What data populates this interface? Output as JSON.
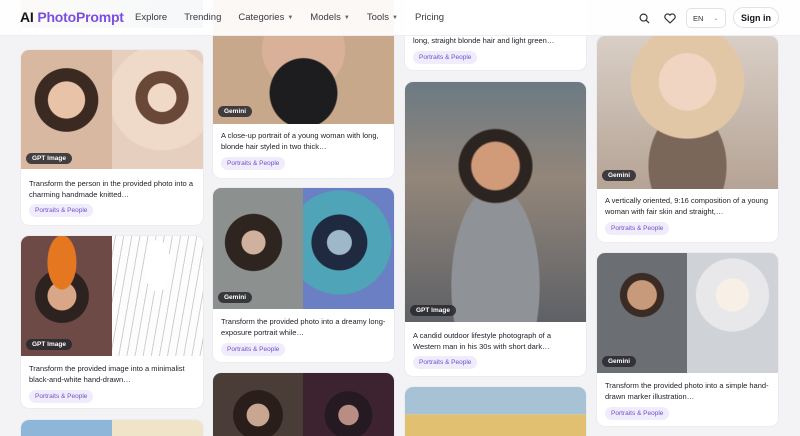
{
  "app": {
    "logo_prefix": "AI",
    "logo_name": "PhotoPrompt"
  },
  "nav": {
    "items": [
      {
        "label": "Explore",
        "dropdown": false
      },
      {
        "label": "Trending",
        "dropdown": false
      },
      {
        "label": "Categories",
        "dropdown": true
      },
      {
        "label": "Models",
        "dropdown": true
      },
      {
        "label": "Tools",
        "dropdown": true
      },
      {
        "label": "Pricing",
        "dropdown": false
      }
    ]
  },
  "header": {
    "language": "EN",
    "signin_label": "Sign in",
    "icons": [
      "search-icon",
      "heart-icon"
    ]
  },
  "colors": {
    "brand": "#7b4fe0",
    "tag_bg": "#f0ecfb",
    "tag_text": "#6d52c8",
    "badge_bg": "#2a2a30"
  },
  "cards": {
    "c1": {
      "model": "GPT Image",
      "description": "Transform the person in the provided photo into a charming handmade knitted…",
      "tag": "Portraits & People"
    },
    "c2": {
      "model": "GPT Image",
      "description": "Transform the provided image into a minimalist black-and-white hand-drawn…",
      "tag": "Portraits & People"
    },
    "c3": {
      "model": "Gemini",
      "description": "A close-up portrait of a young woman with long, blonde hair styled in two thick…",
      "tag": "Portraits & People"
    },
    "c4": {
      "model": "Gemini",
      "description": "Transform the provided photo into a dreamy long-exposure portrait while…",
      "tag": "Portraits & People"
    },
    "c5": {
      "description": "long, straight blonde hair and light green…",
      "tag": "Portraits & People"
    },
    "c6": {
      "model": "GPT Image",
      "description": "A candid outdoor lifestyle photograph of a Western man in his 30s with short dark…",
      "tag": "Portraits & People"
    },
    "c7": {
      "model": "Gemini",
      "description": "A vertically oriented, 9:16 composition of a young woman with fair skin and straight,…",
      "tag": "Portraits & People"
    },
    "c8": {
      "model": "Gemini",
      "description": "Transform the provided photo into a simple hand-drawn marker illustration…",
      "tag": "Portraits & People"
    }
  }
}
